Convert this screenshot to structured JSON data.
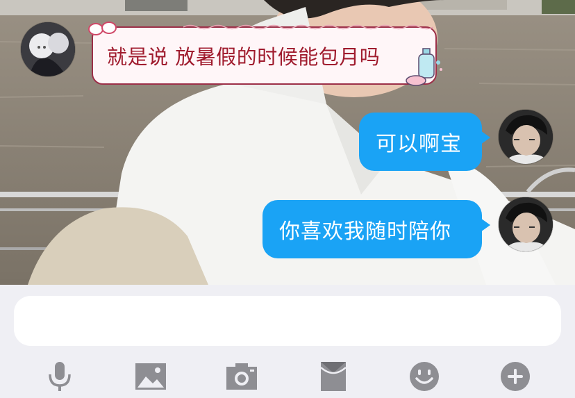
{
  "conversation": {
    "messages": [
      {
        "side": "incoming",
        "text": "就是说 放暑假的时候能包月吗"
      },
      {
        "side": "outgoing",
        "text": "可以啊宝"
      },
      {
        "side": "outgoing",
        "text": "你喜欢我随时陪你"
      }
    ]
  },
  "input": {
    "value": "",
    "placeholder": ""
  },
  "toolbar": {
    "items": [
      "microphone-icon",
      "image-icon",
      "camera-icon",
      "red-packet-icon",
      "emoji-icon",
      "add-icon"
    ]
  },
  "colors": {
    "outgoing_bubble": "#1aa3f5",
    "incoming_bubble_border": "#9c2f48",
    "incoming_text": "#a01c2e",
    "toolbar_icon": "#8e8e93",
    "panel_background": "#efeff4"
  }
}
